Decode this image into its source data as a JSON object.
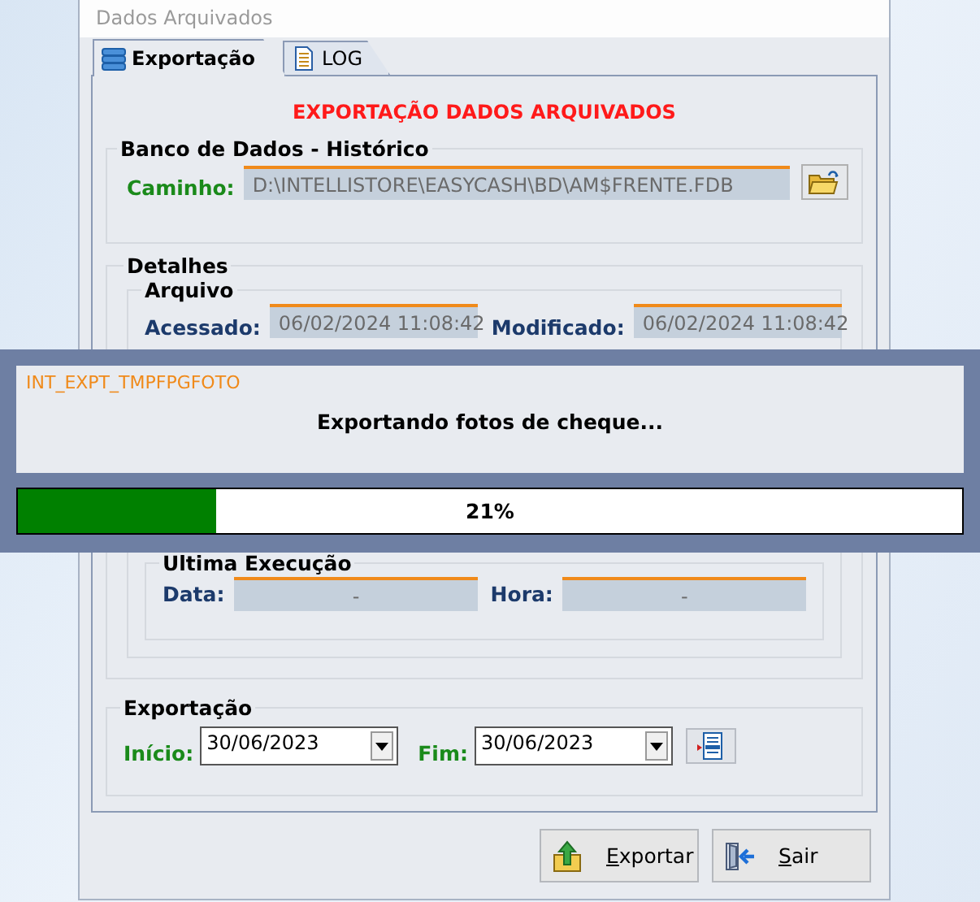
{
  "window": {
    "title": "Dados Arquivados"
  },
  "tabs": [
    {
      "label": "Exportação",
      "selected": true
    },
    {
      "label": "LOG",
      "selected": false
    }
  ],
  "heading": "EXPORTAÇÃO DADOS ARQUIVADOS",
  "database_group": {
    "title": "Banco de Dados - Histórico",
    "path_label": "Caminho:",
    "path_value": "D:\\INTELLISTORE\\EASYCASH\\BD\\AM$FRENTE.FDB"
  },
  "details_group": {
    "title": "Detalhes",
    "file_group": {
      "title": "Arquivo",
      "fields": [
        {
          "label": "Acessado:",
          "value": "06/02/2024 11:08:42"
        },
        {
          "label": "Modificado:",
          "value": "06/02/2024 11:08:42"
        }
      ]
    },
    "last_run_group": {
      "title": "Ultima Execução",
      "fields": [
        {
          "label": "Data:",
          "value": "-"
        },
        {
          "label": "Hora:",
          "value": "-"
        }
      ]
    }
  },
  "export_group": {
    "title": "Exportação",
    "fields": [
      {
        "label": "Início:",
        "value": "30/06/2023"
      },
      {
        "label": "Fim:",
        "value": "30/06/2023"
      }
    ]
  },
  "buttons": [
    {
      "label": "Exportar"
    },
    {
      "label": "Sair"
    }
  ],
  "progress_dialog": {
    "task": "INT_EXPT_TMPFPGFOTO",
    "message": "Exportando fotos de cheque...",
    "level": 0.21,
    "reading": "21%"
  }
}
